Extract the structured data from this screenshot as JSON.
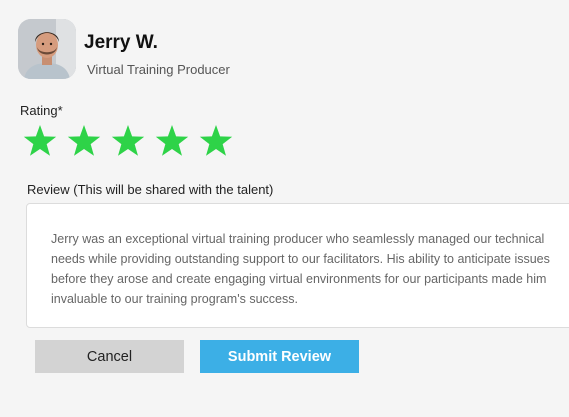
{
  "profile": {
    "name": "Jerry W.",
    "role": "Virtual Training Producer",
    "avatar_icon": "person-photo"
  },
  "rating": {
    "label": "Rating*",
    "value": 5,
    "max": 5,
    "star_color": "#2ed348"
  },
  "review": {
    "label": "Review (This will be shared with the talent)",
    "text": "Jerry was an exceptional virtual training producer who seamlessly managed our technical needs while providing outstanding support to our facilitators. His ability to anticipate issues before they arose and create engaging virtual environments for our participants made him invaluable to our training program's success."
  },
  "actions": {
    "cancel_label": "Cancel",
    "submit_label": "Submit Review",
    "submit_color": "#3cafe6"
  }
}
